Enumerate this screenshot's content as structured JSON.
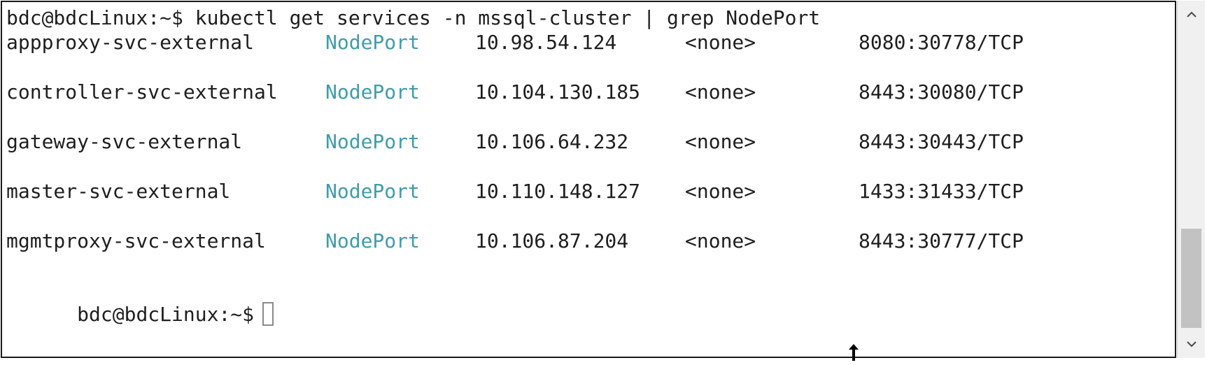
{
  "terminal": {
    "command_line": "bdc@bdcLinux:~$ kubectl get services -n mssql-cluster | grep NodePort",
    "rows": [
      {
        "name": "appproxy-svc-external",
        "type": "NodePort",
        "cluster_ip": "10.98.54.124",
        "external_ip": "<none>",
        "ports": "8080:30778/TCP"
      },
      {
        "name": "controller-svc-external",
        "type": "NodePort",
        "cluster_ip": "10.104.130.185",
        "external_ip": "<none>",
        "ports": "8443:30080/TCP"
      },
      {
        "name": "gateway-svc-external",
        "type": "NodePort",
        "cluster_ip": "10.106.64.232",
        "external_ip": "<none>",
        "ports": "8443:30443/TCP"
      },
      {
        "name": "master-svc-external",
        "type": "NodePort",
        "cluster_ip": "10.110.148.127",
        "external_ip": "<none>",
        "ports": "1433:31433/TCP"
      },
      {
        "name": "mgmtproxy-svc-external",
        "type": "NodePort",
        "cluster_ip": "10.106.87.204",
        "external_ip": "<none>",
        "ports": "8443:30777/TCP"
      }
    ],
    "prompt": "bdc@bdcLinux:~$"
  },
  "icons": {
    "scroll_up": "chevron-up-icon",
    "scroll_down": "chevron-down-icon",
    "pointer": "mouse-pointer-icon"
  },
  "colors": {
    "text": "#1e1e1e",
    "nodeport": "#3f9cac",
    "background": "#ffffff",
    "scrollbar_track": "#f0f0f0",
    "scrollbar_thumb": "#c2c2c2"
  }
}
